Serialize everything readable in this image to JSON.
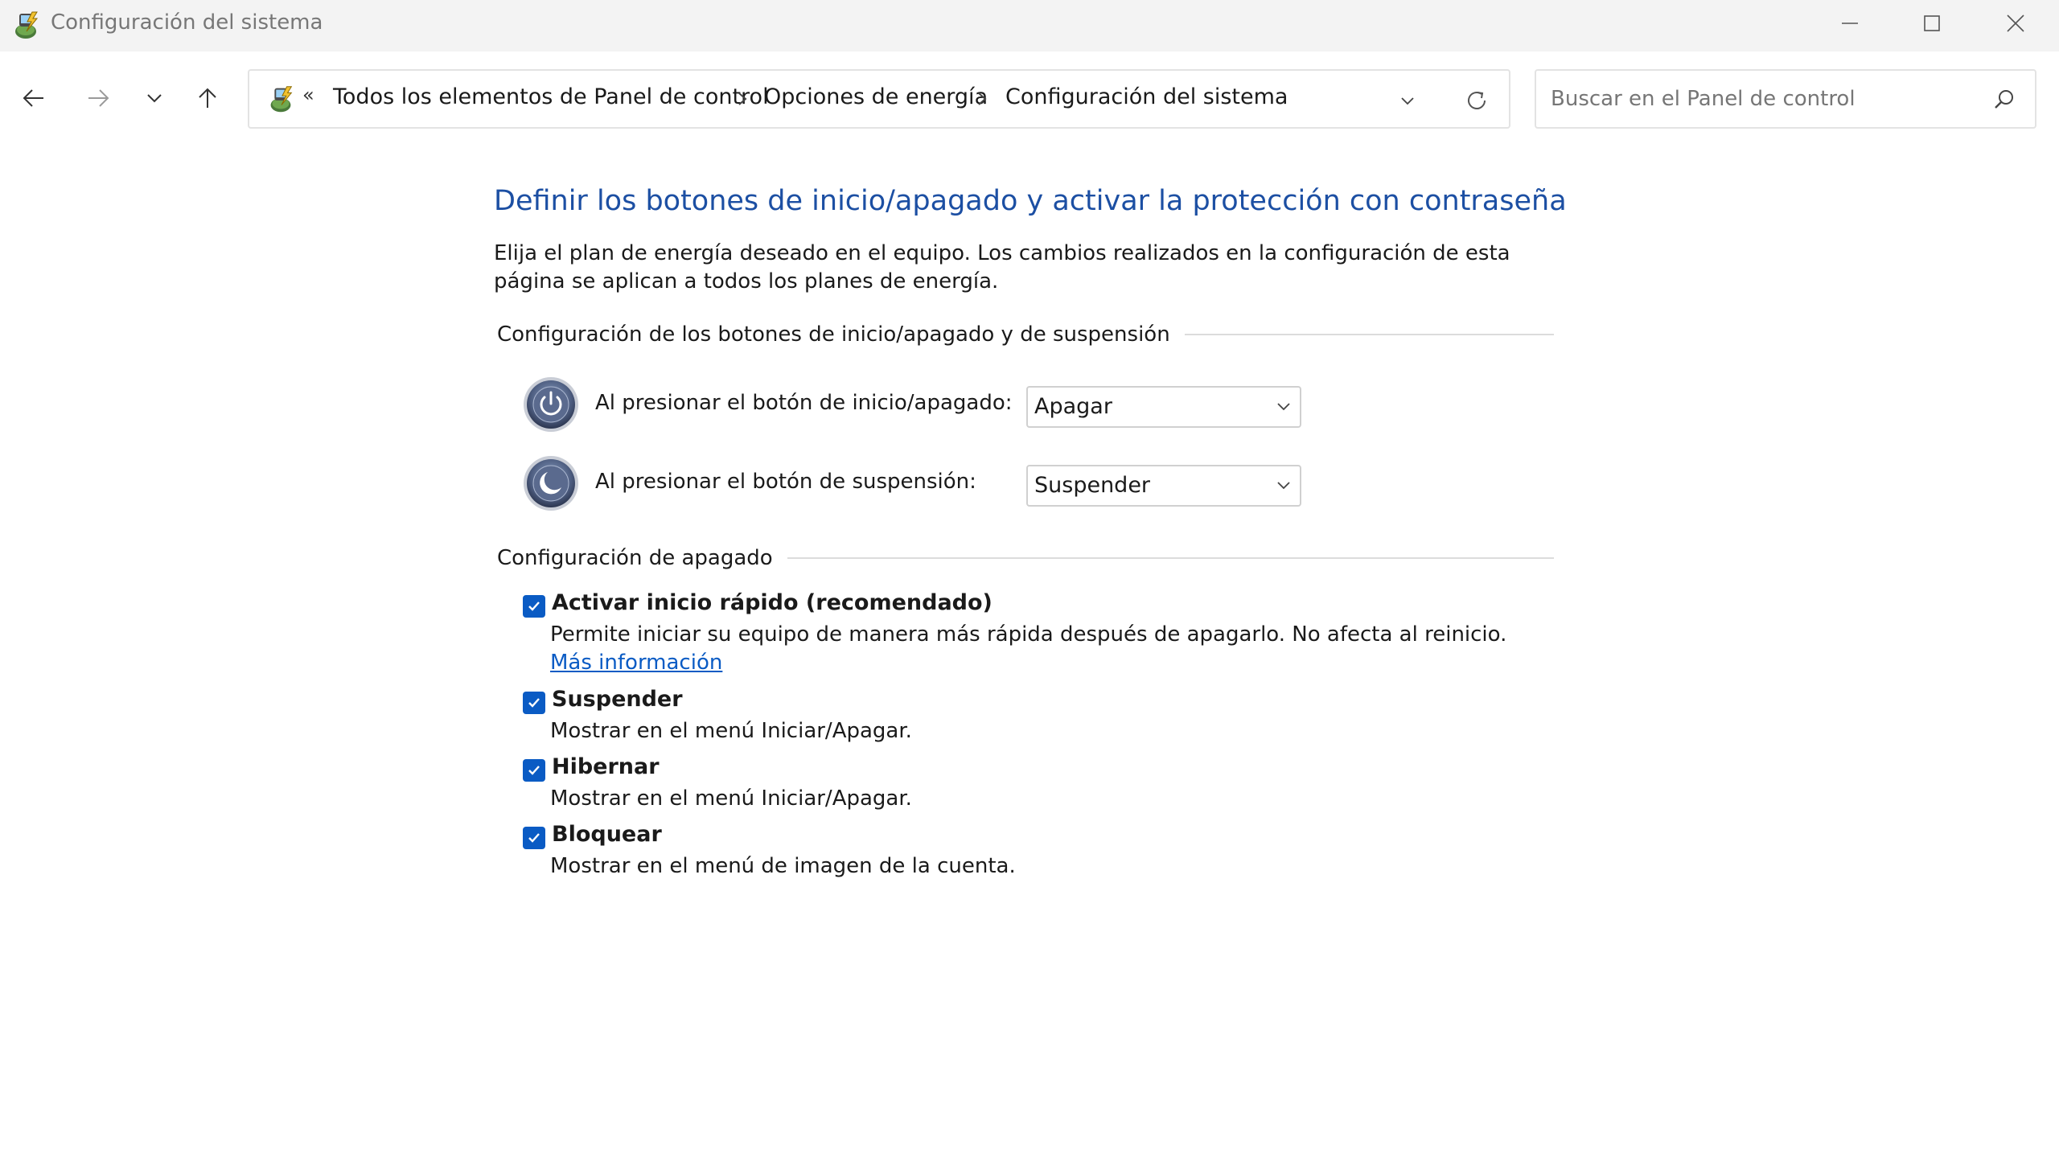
{
  "window": {
    "title": "Configuración del sistema"
  },
  "nav": {
    "back_icon": "arrow-left-icon",
    "forward_icon": "arrow-right-icon",
    "recent_icon": "chevron-down-icon",
    "up_icon": "arrow-up-icon"
  },
  "address": {
    "more": "«",
    "crumbs": [
      "Todos los elementos de Panel de control",
      "Opciones de energía",
      "Configuración del sistema"
    ]
  },
  "search": {
    "placeholder": "Buscar en el Panel de control",
    "value": ""
  },
  "page": {
    "title": "Definir los botones de inicio/apagado y activar la protección con contraseña",
    "description": "Elija el plan de energía deseado en el equipo. Los cambios realizados en la configuración de esta página se aplican a todos los planes de energía."
  },
  "buttons_section": {
    "heading": "Configuración de los botones de inicio/apagado y de suspensión",
    "power": {
      "label": "Al presionar el botón de inicio/apagado:",
      "value": "Apagar"
    },
    "sleep": {
      "label": "Al presionar el botón de suspensión:",
      "value": "Suspender"
    }
  },
  "shutdown_section": {
    "heading": "Configuración de apagado",
    "items": [
      {
        "label": "Activar inicio rápido (recomendado)",
        "description": "Permite iniciar su equipo de manera más rápida después de apagarlo. No afecta al reinicio.",
        "link": "Más información",
        "checked": true
      },
      {
        "label": "Suspender",
        "description": "Mostrar en el menú Iniciar/Apagar.",
        "checked": true
      },
      {
        "label": "Hibernar",
        "description": "Mostrar en el menú Iniciar/Apagar.",
        "checked": true
      },
      {
        "label": "Bloquear",
        "description": "Mostrar en el menú de imagen de la cuenta.",
        "checked": true
      }
    ]
  },
  "colors": {
    "title_blue": "#1c4fa3",
    "checkbox_blue": "#0a5bc4",
    "link_blue": "#0a5bc4"
  }
}
